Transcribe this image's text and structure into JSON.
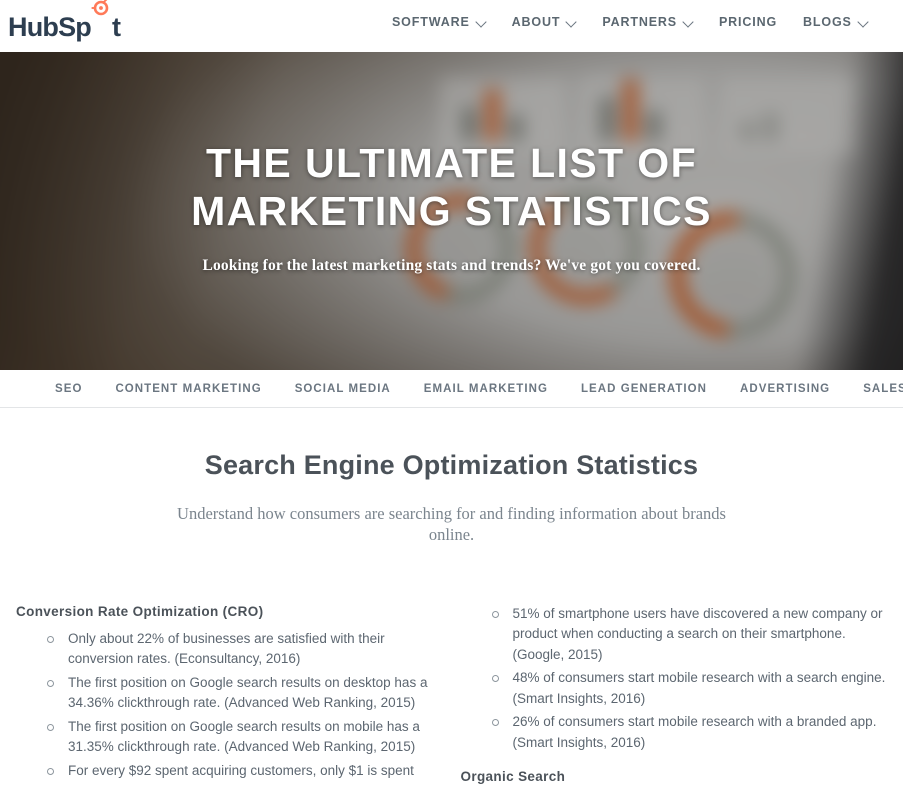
{
  "brand": {
    "logo_text_main": "HubSp",
    "logo_text_tail": "t",
    "accent_color": "#ff7a59",
    "logo_color": "#2d3e50"
  },
  "topnav": {
    "items": [
      {
        "label": "SOFTWARE",
        "has_dropdown": true,
        "icon": "chevron-down-icon"
      },
      {
        "label": "ABOUT",
        "has_dropdown": true,
        "icon": "chevron-down-icon"
      },
      {
        "label": "PARTNERS",
        "has_dropdown": true,
        "icon": "chevron-down-icon"
      },
      {
        "label": "PRICING",
        "has_dropdown": false
      },
      {
        "label": "BLOGS",
        "has_dropdown": true,
        "icon": "chevron-down-icon"
      }
    ]
  },
  "hero": {
    "title_line1": "THE ULTIMATE LIST OF",
    "title_line2": "MARKETING STATISTICS",
    "subtitle": "Looking for the latest marketing stats and trends? We've got you covered.",
    "background_description": "blurred photo of tablet dashboard with orange donut charts on wooden desk",
    "accent_color": "#d9652a",
    "wood_color": "#4e4031"
  },
  "category_nav": {
    "items": [
      "SEO",
      "CONTENT MARKETING",
      "SOCIAL MEDIA",
      "EMAIL MARKETING",
      "LEAD GENERATION",
      "ADVERTISING",
      "SALES"
    ]
  },
  "section": {
    "title": "Search Engine Optimization Statistics",
    "subtitle": "Understand how consumers are searching for and finding information about brands online."
  },
  "left_column": {
    "heading": "Conversion Rate Optimization (CRO)",
    "bullets": [
      "Only about 22% of businesses are satisfied with their conversion rates. (Econsultancy, 2016)",
      "The first position on Google search results on desktop has a 34.36% clickthrough rate. (Advanced Web Ranking, 2015)",
      "The first position on Google search results on mobile has a 31.35% clickthrough rate. (Advanced Web Ranking, 2015)",
      "For every $92 spent acquiring customers, only $1 is spent"
    ]
  },
  "right_column": {
    "bullets": [
      "51% of smartphone users have discovered a new company or product when conducting a search on their smartphone. (Google, 2015)",
      "48% of consumers start mobile research with a search engine. (Smart Insights, 2016)",
      "26% of consumers start mobile research with a branded app. (Smart Insights, 2016)"
    ],
    "heading": "Organic Search"
  }
}
